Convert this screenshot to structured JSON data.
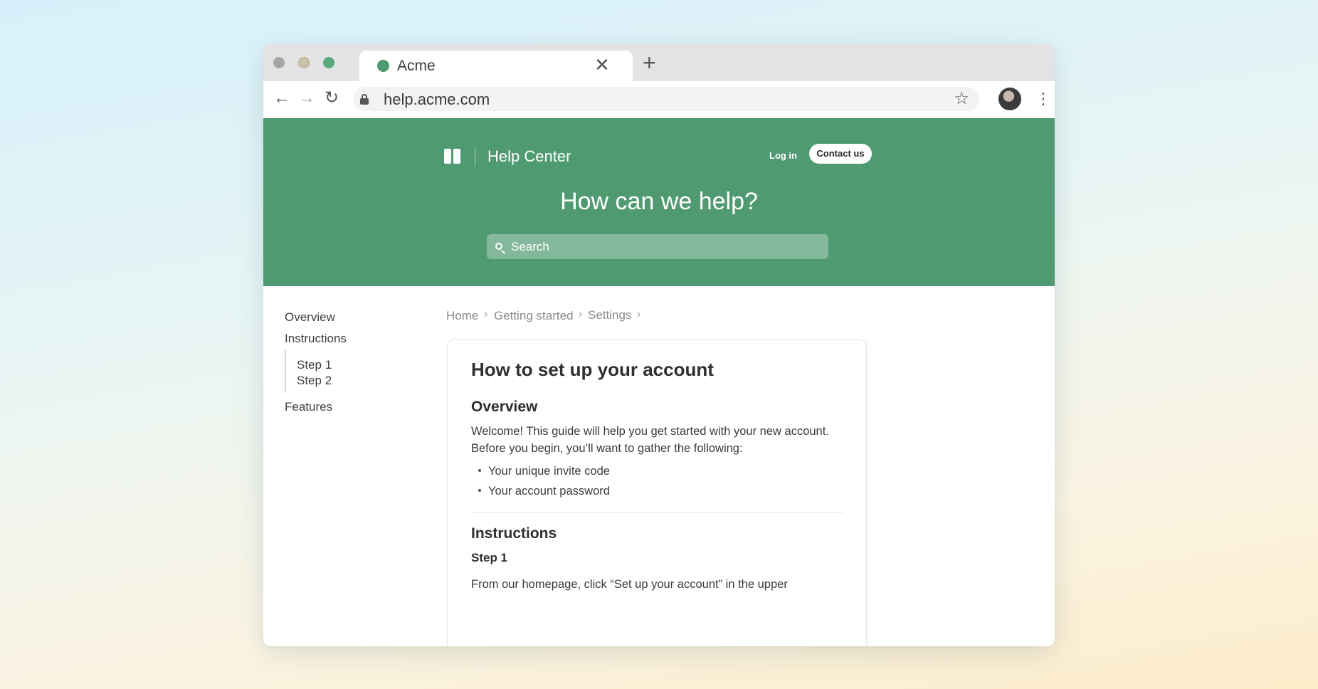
{
  "browser": {
    "tab_title": "Acme",
    "close_glyph": "✕",
    "newtab_glyph": "+",
    "url": "help.acme.com",
    "back_glyph": "←",
    "forward_glyph": "→",
    "reload_glyph": "↻",
    "star_glyph": "☆",
    "menu_glyph": "⋮"
  },
  "header": {
    "brand": "Help Center",
    "login_label": "Log in",
    "contact_label": "Contact us",
    "headline": "How can we help?",
    "search_placeholder": "Search"
  },
  "sidebar": {
    "items": [
      "Overview",
      "Instructions",
      "Features"
    ],
    "subitems": [
      "Step 1",
      "Step 2"
    ]
  },
  "breadcrumb": {
    "items": [
      "Home",
      "Getting started",
      "Settings"
    ],
    "separator": "›"
  },
  "article": {
    "title": "How to set up your account",
    "overview_heading": "Overview",
    "overview_text": "Welcome! This guide will help you get started with your new account. Before you begin, you’ll want to gather the following:",
    "bullets": [
      "Your unique invite code",
      "Your account password"
    ],
    "instructions_heading": "Instructions",
    "step1_label": "Step 1",
    "step1_text": "From our homepage, click “Set up your account” in the upper"
  },
  "colors": {
    "brand_green": "#4f9a71",
    "page_gradient_top": "#d6f1fb",
    "page_gradient_bottom": "#fcecc9"
  }
}
